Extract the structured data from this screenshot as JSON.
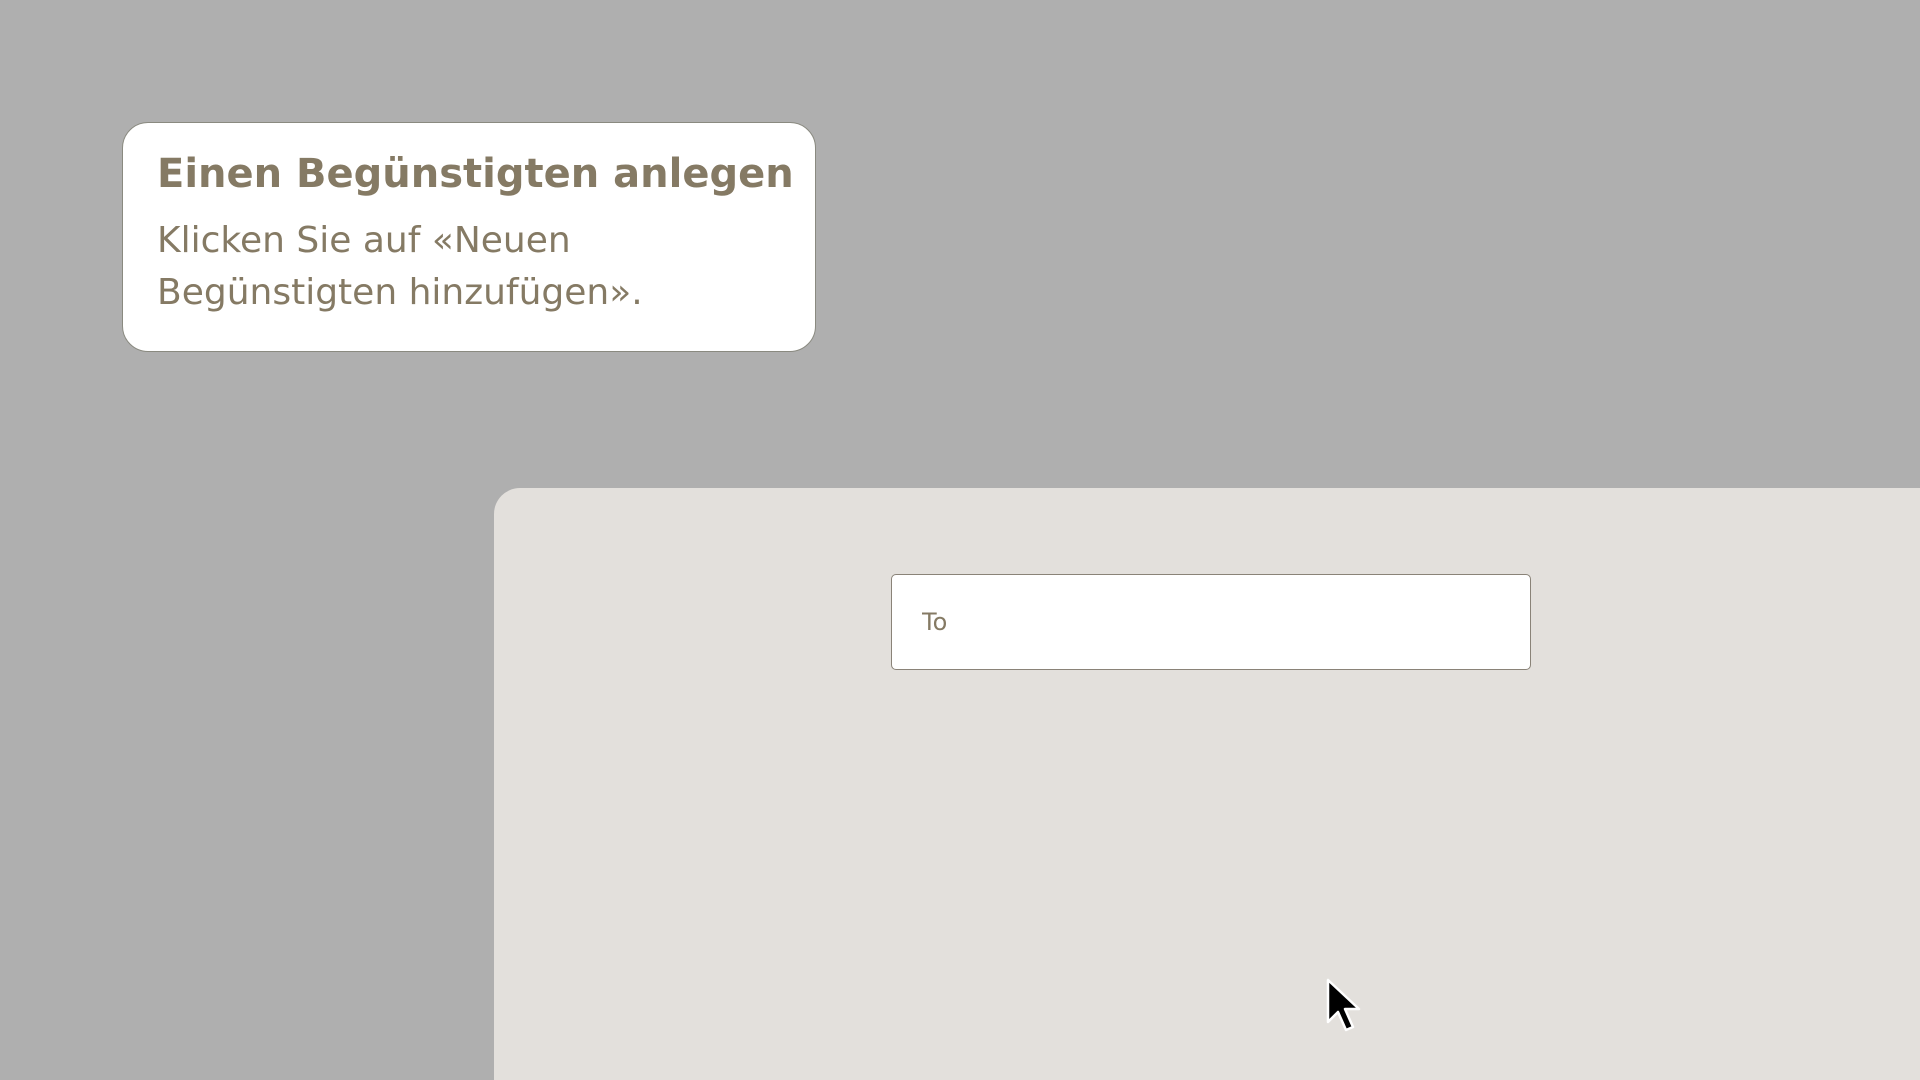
{
  "tooltip": {
    "title": "Einen Begünstigten anlegen",
    "body": "Klicken Sie auf «Neuen Begünstigten hinzufügen»."
  },
  "form": {
    "to_field": {
      "placeholder": "To",
      "value": ""
    }
  },
  "colors": {
    "backdrop": "#afafaf",
    "panel": "#e3e0dc",
    "tooltip_text": "#857a64"
  },
  "icons": {
    "pointer": "mouse-cursor-icon"
  }
}
